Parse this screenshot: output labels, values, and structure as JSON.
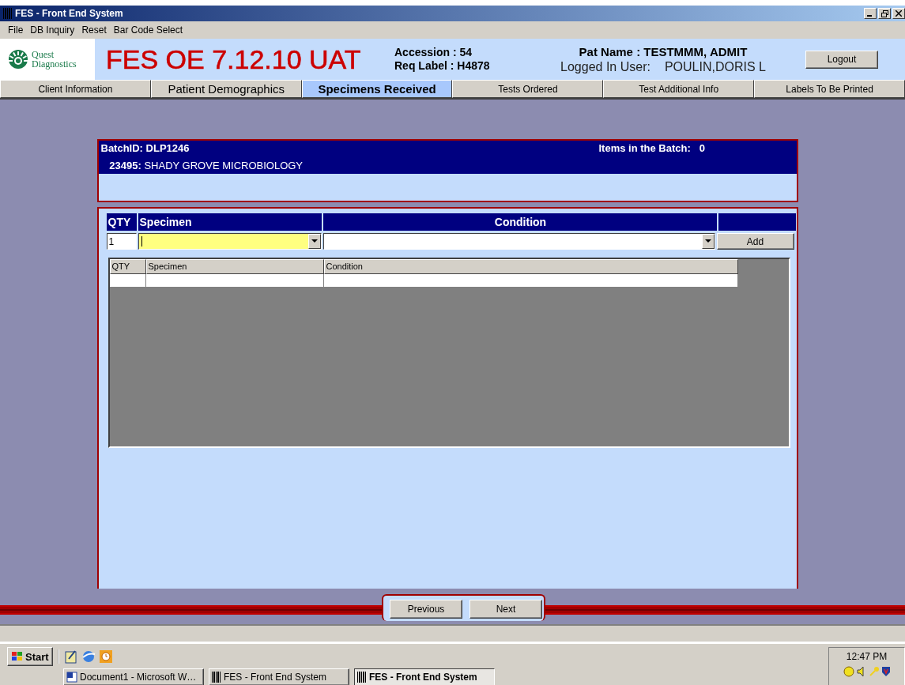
{
  "window": {
    "title": "FES - Front End System"
  },
  "menu": [
    "File",
    "DB Inquiry",
    "Reset",
    "Bar Code Select"
  ],
  "header": {
    "logo_line1": "Quest",
    "logo_line2": "Diagnostics",
    "app_title": "FES OE 7.12.10 UAT",
    "accession": "Accession : 54",
    "req_label": "Req Label : H4878",
    "pat_name": "Pat Name : TESTMMM, ADMIT",
    "logged_in_label": "Logged In User:",
    "logged_in_user": "POULIN,DORIS L",
    "logout": "Logout"
  },
  "tabs": [
    {
      "label": "Client Information",
      "selected": false
    },
    {
      "label": "Patient Demographics",
      "selected": false
    },
    {
      "label": "Specimens Received",
      "selected": true
    },
    {
      "label": "Tests Ordered",
      "selected": false
    },
    {
      "label": "Test Additional Info",
      "selected": false
    },
    {
      "label": "Labels To Be Printed",
      "selected": false
    }
  ],
  "batch": {
    "batch_id_label": "BatchID:",
    "batch_id": "DLP1246",
    "items_label": "Items in the Batch:",
    "items_count": "0",
    "client_code": "23495:",
    "client_name": "SHADY GROVE MICROBIOLOGY"
  },
  "entry": {
    "columns": [
      "QTY",
      "Specimen",
      "Condition"
    ],
    "qty_value": "1",
    "add": "Add"
  },
  "grid": {
    "columns": [
      "QTY",
      "Specimen",
      "Condition"
    ]
  },
  "nav": [
    "Previous",
    "Next"
  ],
  "taskbar": {
    "start": "Start",
    "tasks": [
      {
        "label": "Document1 - Microsoft W…",
        "selected": false
      },
      {
        "label": "FES - Front End System",
        "selected": false
      },
      {
        "label": "FES - Front End System",
        "selected": true
      }
    ],
    "clock": "12:47 PM"
  }
}
